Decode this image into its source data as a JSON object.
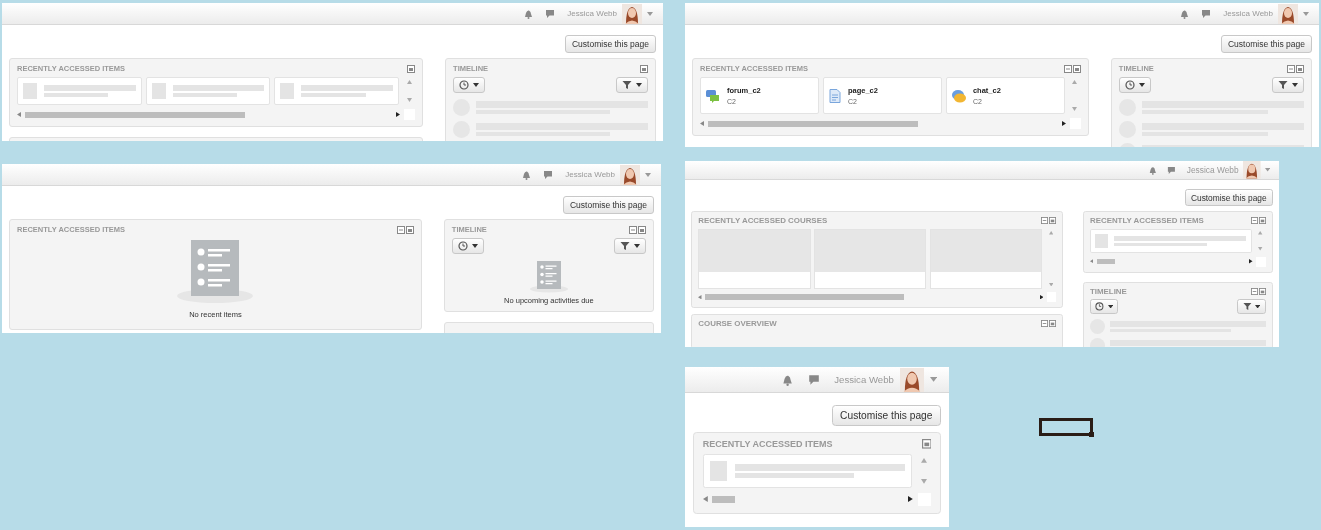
{
  "screenshots": [
    {
      "user_name": "Jessica Webb",
      "customise_button": "Customise this page",
      "main": [
        {
          "kind": "items",
          "title": "RECENTLY ACCESSED ITEMS",
          "collapsible": false,
          "cards": [
            {
              "kind": "placeholder"
            },
            {
              "kind": "placeholder"
            },
            {
              "kind": "placeholder"
            }
          ]
        },
        {
          "kind": "stub"
        }
      ],
      "side": [
        {
          "kind": "timeline",
          "title": "TIMELINE",
          "collapsible": false,
          "rows": [
            {
              "kind": "placeholder"
            },
            {
              "kind": "placeholder"
            }
          ]
        }
      ]
    },
    {
      "user_name": "Jessica Webb",
      "customise_button": "Customise this page",
      "main": [
        {
          "kind": "empty",
          "title": "RECENTLY ACCESSED ITEMS",
          "collapsible": true,
          "message": "No recent items"
        }
      ],
      "side": [
        {
          "kind": "timeline",
          "title": "TIMELINE",
          "collapsible": true,
          "message": "No upcoming activities due"
        },
        {
          "kind": "stub"
        }
      ]
    },
    {
      "user_name": "Jessica Webb",
      "customise_button": "Customise this page",
      "main": [
        {
          "kind": "items",
          "title": "RECENTLY ACCESSED ITEMS",
          "collapsible": true,
          "cards": [
            {
              "kind": "forum",
              "name": "forum_c2",
              "course": "C2"
            },
            {
              "kind": "page",
              "name": "page_c2",
              "course": "C2"
            },
            {
              "kind": "chat",
              "name": "chat_c2",
              "course": "C2"
            }
          ]
        }
      ],
      "side": [
        {
          "kind": "timeline",
          "title": "TIMELINE",
          "collapsible": true,
          "rows": [
            {
              "kind": "placeholder"
            },
            {
              "kind": "placeholder"
            },
            {
              "kind": "placeholder"
            }
          ]
        }
      ]
    },
    {
      "user_name": "Jessica Webb",
      "customise_button": "Customise this page",
      "main": [
        {
          "kind": "courses",
          "title": "RECENTLY ACCESSED COURSES",
          "collapsible": true,
          "cards": [
            {
              "kind": "placeholder"
            },
            {
              "kind": "placeholder"
            },
            {
              "kind": "placeholder"
            }
          ]
        },
        {
          "kind": "stub",
          "title": "COURSE OVERVIEW",
          "collapsible": true
        }
      ],
      "side": [
        {
          "kind": "items",
          "title": "RECENTLY ACCESSED ITEMS",
          "collapsible": true,
          "cards": [
            {
              "kind": "placeholder"
            }
          ]
        },
        {
          "kind": "timeline",
          "title": "TIMELINE",
          "collapsible": true,
          "rows": [
            {
              "kind": "placeholder"
            },
            {
              "kind": "placeholder"
            }
          ]
        }
      ]
    },
    {
      "user_name": "Jessica Webb",
      "customise_button": "Customise this page",
      "main": [
        {
          "kind": "items",
          "title": "RECENTLY ACCESSED ITEMS",
          "collapsible": false,
          "cards": [
            {
              "kind": "placeholder"
            }
          ]
        }
      ]
    }
  ]
}
